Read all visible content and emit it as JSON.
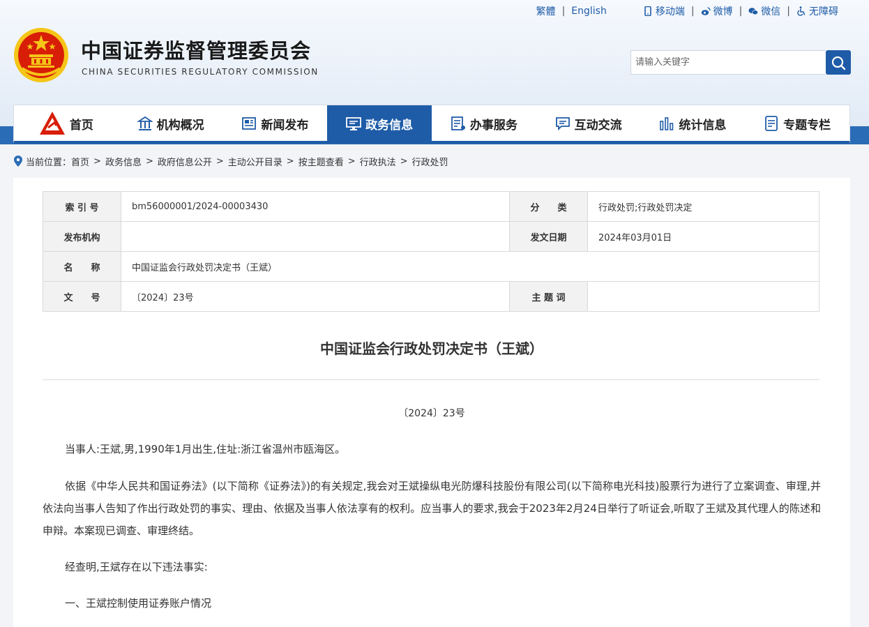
{
  "toplinks": {
    "traditional": "繁體",
    "english": "English",
    "mobile": "移动端",
    "weibo": "微博",
    "wechat": "微信",
    "accessibility": "无障碍"
  },
  "header": {
    "title_cn": "中国证券监督管理委员会",
    "title_en": "CHINA SECURITIES REGULATORY COMMISSION"
  },
  "search": {
    "placeholder": "请输入关键字"
  },
  "nav": {
    "items": [
      {
        "label": "首页",
        "icon": "csrc-logo-icon"
      },
      {
        "label": "机构概况",
        "icon": "building-icon"
      },
      {
        "label": "新闻发布",
        "icon": "newspaper-icon"
      },
      {
        "label": "政务信息",
        "icon": "monitor-icon",
        "active": true
      },
      {
        "label": "办事服务",
        "icon": "service-list-icon"
      },
      {
        "label": "互动交流",
        "icon": "chat-icon"
      },
      {
        "label": "统计信息",
        "icon": "bar-chart-icon"
      },
      {
        "label": "专题专栏",
        "icon": "document-icon"
      }
    ]
  },
  "breadcrumb": {
    "prefix": "当前位置：",
    "items": [
      "首页",
      "政务信息",
      "政府信息公开",
      "主动公开目录",
      "按主题查看",
      "行政执法",
      "行政处罚"
    ]
  },
  "meta": {
    "index_label": "索 引 号",
    "index_value": "bm56000001/2024-00003430",
    "category_label": "分　　类",
    "category_value": "行政处罚;行政处罚决定",
    "publisher_label": "发布机构",
    "publisher_value": "",
    "date_label": "发文日期",
    "date_value": "2024年03月01日",
    "name_label": "名　　称",
    "name_value": "中国证监会行政处罚决定书（王斌）",
    "docno_label": "文　　号",
    "docno_value": "〔2024〕23号",
    "keywords_label": "主 题 词",
    "keywords_value": ""
  },
  "document": {
    "title": "中国证监会行政处罚决定书（王斌）",
    "number": "〔2024〕23号",
    "paragraphs": [
      "当事人:王斌,男,1990年1月出生,住址:浙江省温州市瓯海区。",
      "依据《中华人民共和国证券法》(以下简称《证券法》)的有关规定,我会对王斌操纵电光防爆科技股份有限公司(以下简称电光科技)股票行为进行了立案调查、审理,并依法向当事人告知了作出行政处罚的事实、理由、依据及当事人依法享有的权利。应当事人的要求,我会于2023年2月24日举行了听证会,听取了王斌及其代理人的陈述和申辩。本案现已调查、审理终结。",
      "经查明,王斌存在以下违法事实:",
      "一、王斌控制使用证券账户情况"
    ]
  },
  "colors": {
    "brand_blue": "#1f5ca8",
    "emblem_red": "#d81e06",
    "emblem_gold": "#f5c518"
  }
}
